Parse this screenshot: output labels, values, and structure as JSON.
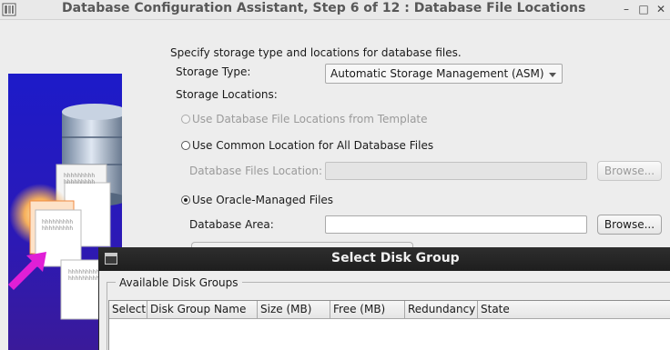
{
  "window": {
    "title": "Database Configuration Assistant, Step 6 of 12 : Database File Locations",
    "minimize_glyph": "–",
    "maximize_glyph": "□",
    "close_glyph": "✕"
  },
  "form": {
    "intro": "Specify storage type and locations for database files.",
    "storage_type_label": "Storage Type:",
    "storage_type_value": "Automatic Storage Management (ASM)",
    "storage_locations_label": "Storage Locations:",
    "option_template": "Use Database File Locations from Template",
    "option_common": "Use Common Location for All Database Files",
    "files_location_label": "Database Files Location:",
    "files_location_value": "",
    "browse_files": "Browse...",
    "option_omf": "Use Oracle-Managed Files",
    "db_area_label": "Database Area:",
    "db_area_value": "",
    "browse_area": "Browse..."
  },
  "dialog": {
    "title": "Select Disk Group",
    "group_label": "Available Disk Groups",
    "columns": [
      "Select",
      "Disk Group Name",
      "Size (MB)",
      "Free (MB)",
      "Redundancy",
      "State"
    ]
  },
  "illustration": {
    "doc_lines": [
      "hhhhhhhhh",
      "hhhhhhhhh",
      "hhhhhhhhh",
      "hhhhhhhhh",
      "hhhhhhhhh",
      "hhhhhhhhh"
    ]
  },
  "colors": {
    "illustration_blue": "#1d1bc9",
    "arrow_magenta": "#e01fd6",
    "dialog_titlebar": "#262626"
  }
}
